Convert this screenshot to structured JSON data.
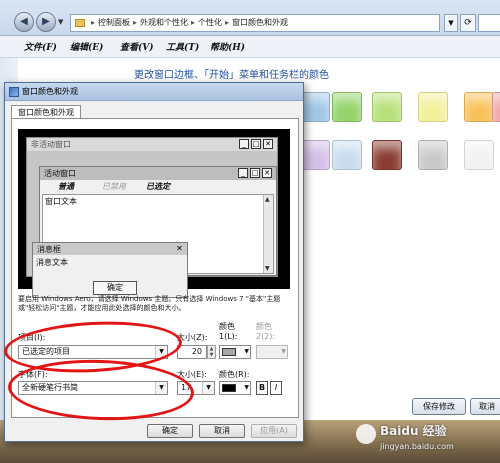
{
  "explorer": {
    "address_segments": [
      "控制面板",
      "外观和个性化",
      "个性化",
      "窗口颜色和外观"
    ],
    "menu": [
      "文件(F)",
      "编辑(E)",
      "查看(V)",
      "工具(T)",
      "帮助(H)"
    ],
    "page_heading": "更改窗口边框、「开始」菜单和任务栏的颜色",
    "swatch_colors_row1": [
      "#9fc7e8",
      "#94d36a",
      "#b8e07a",
      "#f3f09a",
      "#f7c15a",
      "#f0a6a8"
    ],
    "swatch_colors_row2": [
      "#d3bfe7",
      "#c9ddef",
      "#8a3c32",
      "#c9c9c9",
      "#f2f2f2"
    ],
    "save_label": "保存修改",
    "cancel_label": "取消"
  },
  "dialog": {
    "title": "窗口颜色和外观",
    "tab": "窗口颜色和外观",
    "preview": {
      "inactive_title": "非活动窗口",
      "active_title": "活动窗口",
      "menu_normal": "普通",
      "menu_disabled": "已禁用",
      "menu_selected": "已选定",
      "window_text": "窗口文本",
      "msgbox_title": "消息框",
      "msgbox_text": "消息文本",
      "ok_label": "确定"
    },
    "info_text": "要启用 Windows Aero，请选择 Windows 主题。只有选择 Windows 7 \"基本\"主题或\"轻松访问\"主题，才能应用此处选择的颜色和大小。",
    "item_label": "项目(I):",
    "item_value": "已选定的项目",
    "item_size_label": "大小(Z):",
    "item_size_value": "20",
    "color1_label": "颜色 1(L):",
    "color2_label": "颜色 2(2):",
    "color1_value": "#a8a8a8",
    "font_label": "字体(F):",
    "font_value": "全新硬笔行书简",
    "font_size_label": "大小(E):",
    "font_size_value": "17",
    "font_color_label": "颜色(R):",
    "font_color_value": "#000000",
    "bold_label": "B",
    "italic_label": "I",
    "ok_label": "确定",
    "cancel_label": "取消",
    "apply_label": "应用(A)"
  },
  "watermark": {
    "brand": "Baidu 经验",
    "url": "jingyan.baidu.com"
  },
  "annotation_color": "#e21414"
}
